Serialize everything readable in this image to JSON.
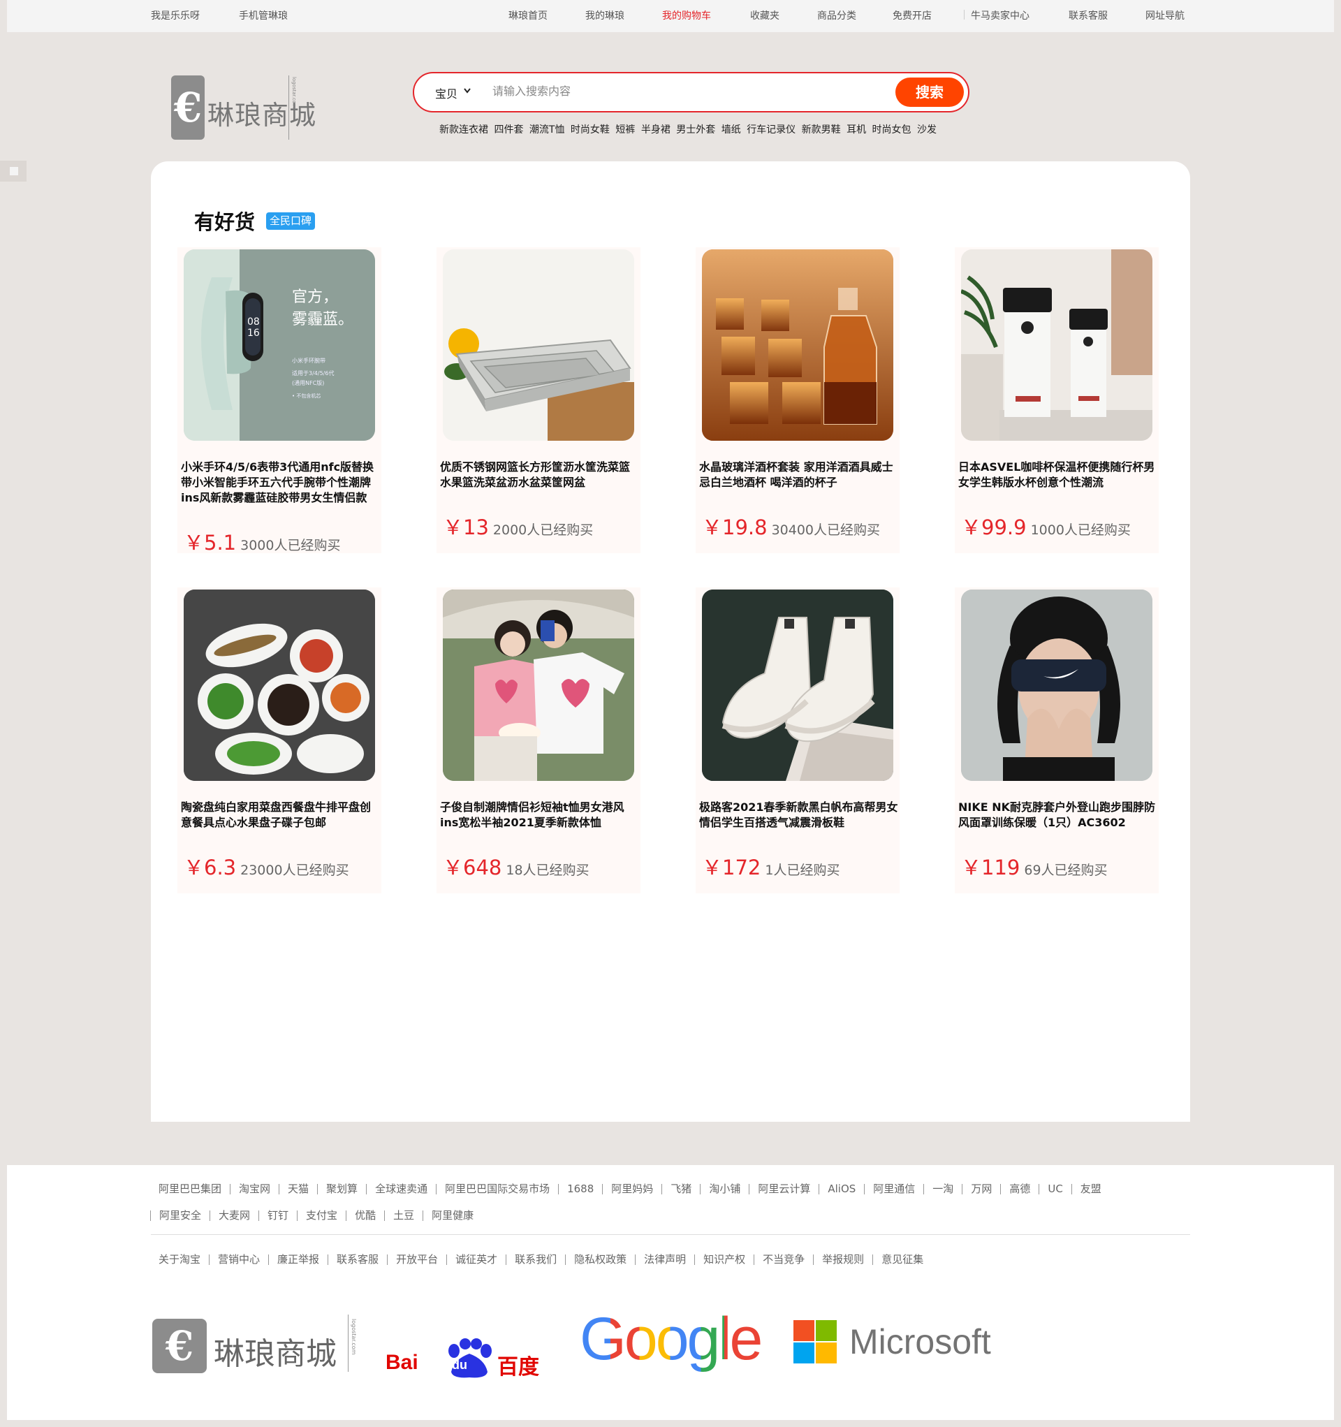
{
  "topbar": {
    "left": [
      "我是乐乐呀",
      "手机管琳琅"
    ],
    "right": [
      "琳琅首页",
      "我的琳琅",
      "我的购物车",
      "收藏夹",
      "商品分类",
      "免费开店",
      "牛马卖家中心",
      "联系客服",
      "网址导航"
    ],
    "active": "我的购物车"
  },
  "logo": {
    "name": "琳琅商城",
    "vertical_text": "logostar.com"
  },
  "search": {
    "type": "宝贝",
    "placeholder": "请输入搜索内容",
    "button": "搜索"
  },
  "hot_words": [
    "新款连衣裙",
    "四件套",
    "潮流T恤",
    "时尚女鞋",
    "短裤",
    "半身裙",
    "男士外套",
    "墙纸",
    "行车记录仪",
    "新款男鞋",
    "耳机",
    "时尚女包",
    "沙发"
  ],
  "section": {
    "title": "有好货",
    "badge": "全民口碑"
  },
  "products": [
    {
      "title": "小米手环4/5/6表带3代通用nfc版替换带小米智能手环五六代手腕带个性潮牌ins风新款雾霾蓝硅胶带男女生情侣款",
      "price": "￥5.1",
      "sold": "3000人已经购买",
      "image": "smart-band-image",
      "image_text": [
        "官方，",
        "雾霾蓝。",
        "小米手环腕带",
        "适用于3/4/5/6代",
        "(通用NFC版)",
        "• 不包含机芯"
      ]
    },
    {
      "title": "优质不锈钢网篮长方形筐沥水筐洗菜篮水果篮洗菜盆沥水盆菜筐网盆",
      "price": "￥13",
      "sold": "2000人已经购买",
      "image": "steel-basket-image"
    },
    {
      "title": "水晶玻璃洋酒杯套装 家用洋酒酒具威士忌白兰地酒杯 喝洋酒的杯子",
      "price": "￥19.8",
      "sold": "30400人已经购买",
      "image": "whisky-glass-image"
    },
    {
      "title": "日本ASVEL咖啡杯保温杯便携随行杯男女学生韩版水杯创意个性潮流",
      "price": "￥99.9",
      "sold": "1000人已经购买",
      "image": "coffee-cup-image"
    },
    {
      "title": "陶瓷盘纯白家用菜盘西餐盘牛排平盘创意餐具点心水果盘子碟子包邮",
      "price": "￥6.3",
      "sold": "23000人已经购买",
      "image": "ceramic-plate-image"
    },
    {
      "title": "子俊自制潮牌情侣衫短袖t恤男女港风ins宽松半袖2021夏季新款体恤",
      "price": "￥648",
      "sold": "18人已经购买",
      "image": "couple-tshirt-image"
    },
    {
      "title": "极路客2021春季新款黑白帆布高帮男女情侣学生百搭透气减震滑板鞋",
      "price": "￥172",
      "sold": "1人已经购买",
      "image": "canvas-shoes-image"
    },
    {
      "title": "NIKE NK耐克脖套户外登山跑步围脖防风面罩训练保暖（1只）AC3602",
      "price": "￥119",
      "sold": "69人已经购买",
      "image": "nike-neck-gaiter-image"
    }
  ],
  "footer": {
    "row1": [
      "阿里巴巴集团",
      "淘宝网",
      "天猫",
      "聚划算",
      "全球速卖通",
      "阿里巴巴国际交易市场",
      "1688",
      "阿里妈妈",
      "飞猪",
      "淘小铺",
      "阿里云计算",
      "AliOS",
      "阿里通信",
      "一淘",
      "万网",
      "高德",
      "UC",
      "友盟"
    ],
    "row2": [
      "阿里安全",
      "大麦网",
      "钉钉",
      "支付宝",
      "优酷",
      "土豆",
      "阿里健康"
    ],
    "row3": [
      "关于淘宝",
      "营销中心",
      "廉正举报",
      "联系客服",
      "开放平台",
      "诚征英才",
      "联系我们",
      "隐私权政策",
      "法律声明",
      "知识产权",
      "不当竞争",
      "举报规则",
      "意见征集"
    ],
    "partners": {
      "logo_name": "琳琅商城",
      "baidu_latin": "Bai",
      "baidu_du": "du",
      "baidu_cn": "百度",
      "google": "Google",
      "microsoft": "Microsoft"
    }
  },
  "colors": {
    "accent": "#e4262b",
    "search_button": "#ff4400",
    "badge": "#2a9ff0",
    "page_bg": "#e8e4e1"
  }
}
